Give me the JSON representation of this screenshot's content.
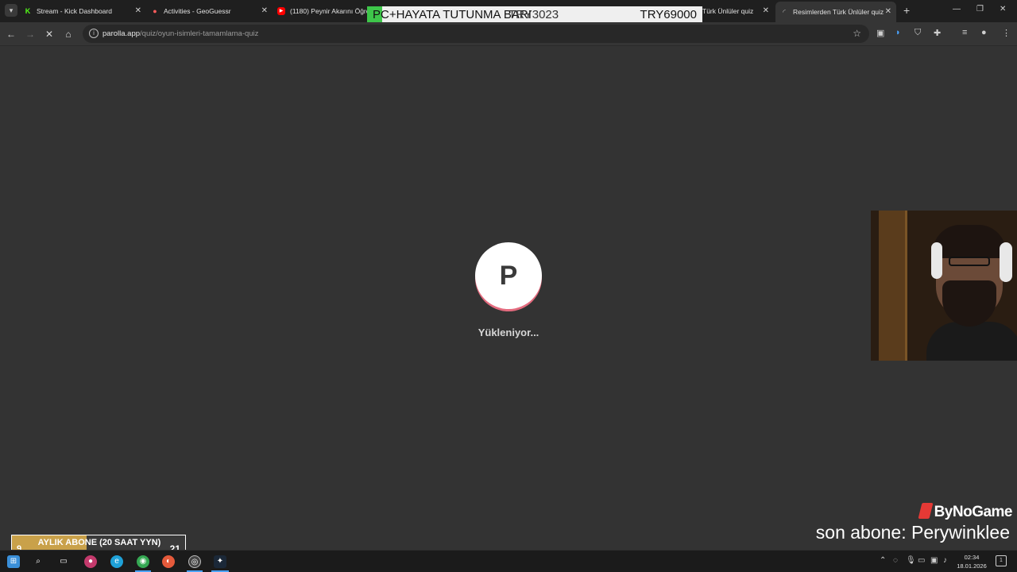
{
  "browser": {
    "tabs": [
      {
        "title": "Stream - Kick Dashboard",
        "icon": "kick-icon"
      },
      {
        "title": "Activities - GeoGuessr",
        "icon": "geoguessr-icon"
      },
      {
        "title": "(1180) Peynir Akarını Öğren",
        "icon": "youtube-icon"
      },
      {
        "title": "Türk Ünlüler quiz",
        "icon": "page-icon"
      },
      {
        "title": "Resimlerden Türk Ünlüler quiz",
        "icon": "loading-icon",
        "active": true
      }
    ],
    "url_domain": "parolla.app",
    "url_path": "/quiz/oyun-isimleri-tamamlama-quiz"
  },
  "stream_overlay": {
    "goal_bar_label": "PC+HAYATA TUTUNMA BARI",
    "goal_current": "TRY3023",
    "goal_target": "TRY69000",
    "goal_progress": 0.044,
    "brand": "ByNoGame",
    "last_subscriber_text": "son abone: Perywinklee",
    "sub_goal": {
      "label": "AYLIK ABONE (20 SAAT YYN)",
      "current": "9",
      "target": "21",
      "progress": 0.43
    }
  },
  "page": {
    "logo_letter": "P",
    "loading_text": "Yükleniyor..."
  },
  "taskbar": {
    "time": "02:34",
    "date": "18.01.2026",
    "notification_count": "1"
  },
  "colors": {
    "background": "#333333",
    "goal_fill": "#3ec64a",
    "sub_goal_fill": "#c9a14a",
    "logo_accent": "#e36b7e",
    "brand_accent": "#e53935"
  }
}
